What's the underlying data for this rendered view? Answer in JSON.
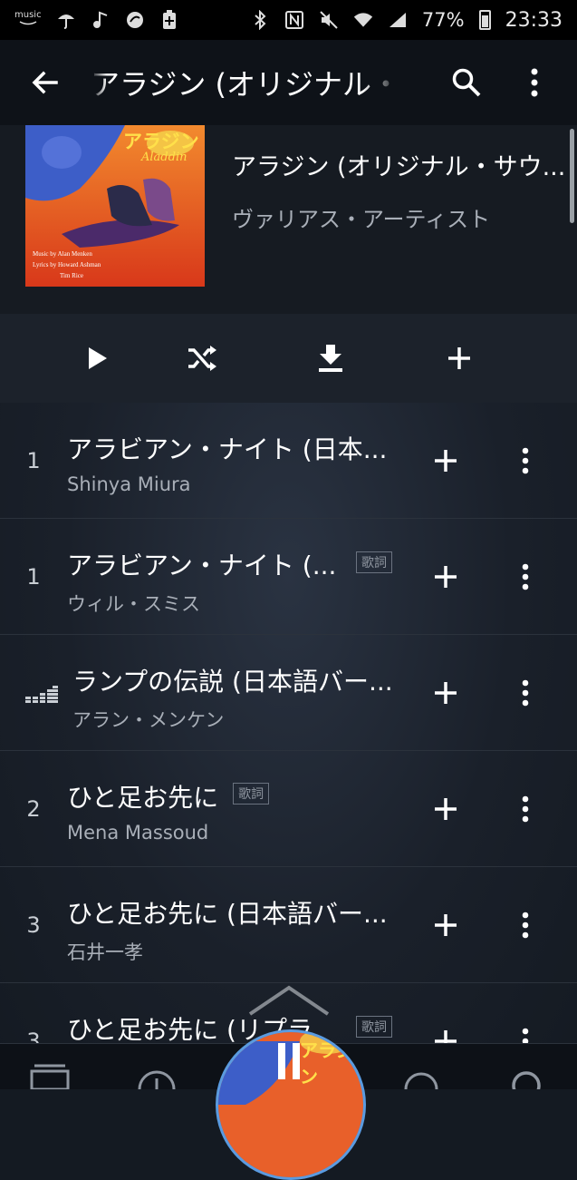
{
  "status_bar": {
    "amazon_label": "music",
    "battery_pct": "77%",
    "time": "23:33"
  },
  "app_bar": {
    "title": "アラジン (オリジナル・サウンドトラック)",
    "back_icon": "arrow-left-icon",
    "search_icon": "search-icon",
    "more_icon": "more-vert-icon"
  },
  "album": {
    "title": "アラジン (オリジナル・サウ...",
    "artist": "ヴァリアス・アーティスト",
    "cover": {
      "logo_text": "アラジン",
      "logo_sub": "Aladdin",
      "credit1": "Music by Alan Menken",
      "credit2": "Lyrics by Howard Ashman",
      "credit3": "Tim Rice"
    }
  },
  "actions": {
    "play_icon": "play-icon",
    "shuffle_icon": "shuffle-icon",
    "download_icon": "download-icon",
    "add_icon": "add-icon"
  },
  "tracks": [
    {
      "num": "1",
      "title": "アラビアン・ナイト (日本...",
      "artist": "Shinya Miura",
      "lyrics": ""
    },
    {
      "num": "1",
      "title": "アラビアン・ナイト (...",
      "artist": "ウィル・スミス",
      "lyrics": "歌詞"
    },
    {
      "num": "",
      "title": "ランプの伝説 (日本語バー...",
      "artist": "アラン・メンケン",
      "lyrics": ""
    },
    {
      "num": "2",
      "title": "ひと足お先に",
      "artist": "Mena Massoud",
      "lyrics": "歌詞"
    },
    {
      "num": "3",
      "title": "ひと足お先に (日本語バー...",
      "artist": "石井一孝",
      "lyrics": ""
    },
    {
      "num": "3",
      "title": "ひと足お先に (リプラ",
      "artist": "",
      "lyrics": "歌詞"
    }
  ],
  "colors": {
    "accent": "#3a7fd6",
    "background": "#141a22",
    "muted_text": "#a9afb8"
  }
}
